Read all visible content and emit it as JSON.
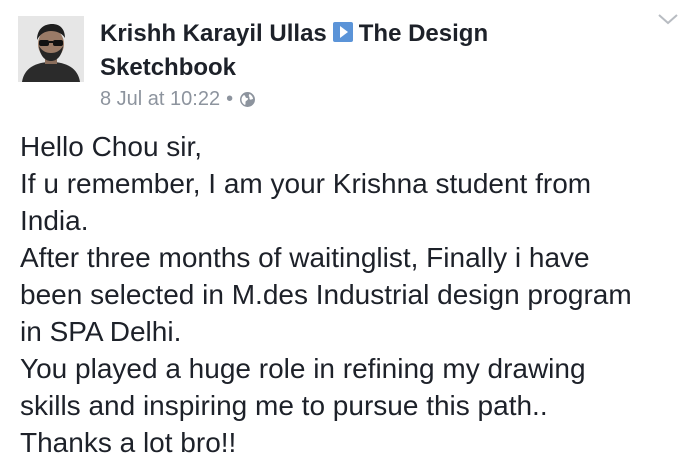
{
  "post": {
    "author_name": "Krishh Karayil Ullas",
    "target_name_line1": "The Design",
    "target_name_line2": "Sketchbook",
    "timestamp": "8 Jul at 10:22",
    "separator": "•",
    "privacy_icon": "globe-icon",
    "share_icon": "play-arrow-icon",
    "menu_icon": "chevron-down-icon",
    "message_lines": [
      "Hello Chou sir,",
      "If u remember, I am your Krishna student from",
      "India.",
      "After three months of waitinglist, Finally i have",
      "been selected in M.des Industrial design program",
      "in SPA Delhi.",
      "You played a huge role in refining my drawing",
      "skills and inspiring me to pursue this path..",
      "Thanks a lot bro!!"
    ]
  },
  "colors": {
    "text_primary": "#1d2129",
    "text_secondary": "#8d949e",
    "share_icon_blue": "#5b94d8",
    "background": "#ffffff"
  }
}
